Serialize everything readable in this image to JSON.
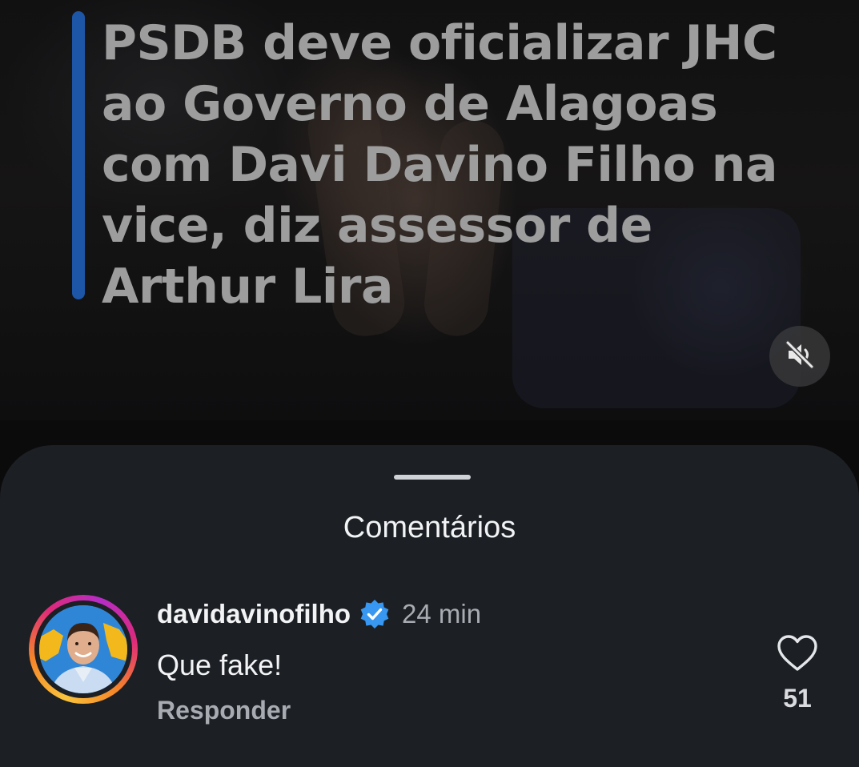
{
  "video": {
    "headline": "PSDB deve oficializar JHC ao Governo de Alagoas com Davi Davino Filho na vice, diz assessor de Arthur Lira",
    "headline_bar_color": "#1d56a6",
    "mute_icon": "speaker-muted-icon"
  },
  "comments_sheet": {
    "title": "Comentários",
    "comments": [
      {
        "username": "davidavinofilho",
        "verified": true,
        "verified_icon": "verified-badge-icon",
        "timestamp": "24 min",
        "text": "Que fake!",
        "reply_label": "Responder",
        "like_icon": "heart-icon",
        "like_count": "51"
      }
    ]
  },
  "colors": {
    "sheet_background": "#1c1f24",
    "primary_text": "#f2f3f5",
    "secondary_text": "#a8acb2",
    "verified_blue": "#3897f0"
  }
}
